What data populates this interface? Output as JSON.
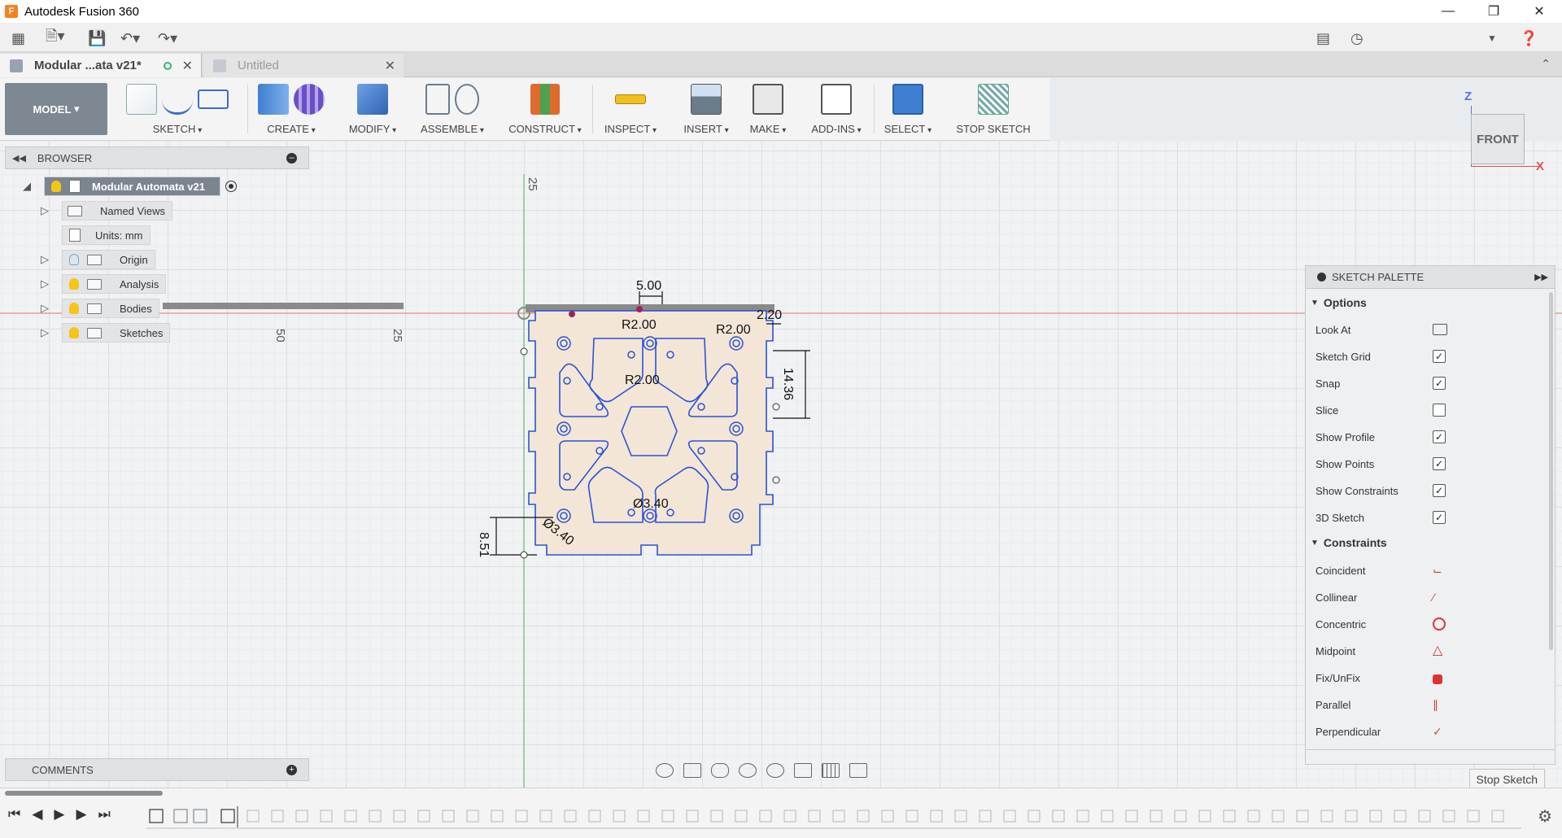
{
  "window": {
    "title": "Autodesk Fusion 360",
    "app_icon": "F"
  },
  "doc_tabs": [
    {
      "label": "Modular ...ata v21*",
      "active": true
    },
    {
      "label": "Untitled",
      "active": false
    }
  ],
  "toolbar": {
    "workspace": "MODEL",
    "groups": [
      "SKETCH",
      "CREATE",
      "MODIFY",
      "ASSEMBLE",
      "CONSTRUCT",
      "INSPECT",
      "INSERT",
      "MAKE",
      "ADD-INS",
      "SELECT",
      "STOP SKETCH"
    ]
  },
  "browser": {
    "title": "BROWSER",
    "root": "Modular Automata v21",
    "items": [
      {
        "label": "Named Views"
      },
      {
        "label": "Units: mm"
      },
      {
        "label": "Origin"
      },
      {
        "label": "Analysis"
      },
      {
        "label": "Bodies"
      },
      {
        "label": "Sketches"
      }
    ]
  },
  "comments": {
    "title": "COMMENTS"
  },
  "viewcube": {
    "face": "FRONT",
    "z": "Z",
    "x": "X"
  },
  "sketch": {
    "dimensions": [
      "5.00",
      "R2.00",
      "R2.00",
      "R2.00",
      "14.36",
      "2.20",
      "Ø3.40",
      "Ø3.40",
      "8.51"
    ],
    "ruler_labels": [
      "25",
      "50",
      "25"
    ]
  },
  "palette": {
    "title": "SKETCH PALETTE",
    "options_title": "Options",
    "options": [
      {
        "label": "Look At",
        "type": "button"
      },
      {
        "label": "Sketch Grid",
        "checked": true
      },
      {
        "label": "Snap",
        "checked": true
      },
      {
        "label": "Slice",
        "checked": false
      },
      {
        "label": "Show Profile",
        "checked": true
      },
      {
        "label": "Show Points",
        "checked": true
      },
      {
        "label": "Show Constraints",
        "checked": true
      },
      {
        "label": "3D Sketch",
        "checked": true
      }
    ],
    "constraints_title": "Constraints",
    "constraints": [
      {
        "label": "Coincident",
        "icon": "coincident-icon"
      },
      {
        "label": "Collinear",
        "icon": "collinear-icon"
      },
      {
        "label": "Concentric",
        "icon": "concentric-icon"
      },
      {
        "label": "Midpoint",
        "icon": "midpoint-icon"
      },
      {
        "label": "Fix/UnFix",
        "icon": "lock-icon"
      },
      {
        "label": "Parallel",
        "icon": "parallel-icon"
      },
      {
        "label": "Perpendicular",
        "icon": "perpendicular-icon"
      }
    ],
    "stop_button": "Stop Sketch"
  },
  "colors": {
    "accent": "#3a6fc4",
    "sketch_line": "#2b52d6",
    "profile_fill": "#f3e6d6",
    "axis_red": "#e88a8a",
    "axis_green": "#6cc16c"
  }
}
